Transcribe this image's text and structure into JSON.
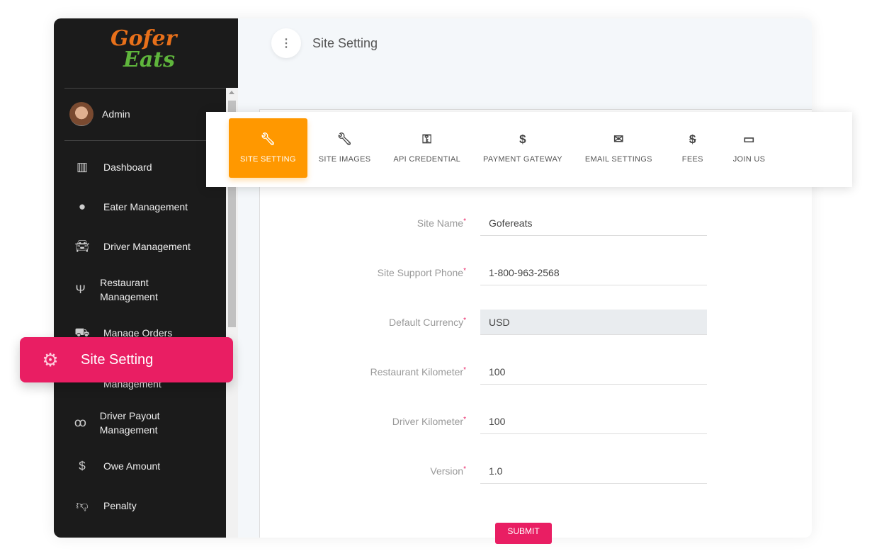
{
  "brand": {
    "logo_text_1": "Gofer",
    "logo_text_2": "Eats"
  },
  "user": {
    "name": "Admin"
  },
  "sidebar": {
    "items": [
      {
        "label": "Dashboard",
        "icon": "bar-chart-icon"
      },
      {
        "label": "Eater Management",
        "icon": "account-circle-icon"
      },
      {
        "label": "Driver Management",
        "icon": "car-icon"
      },
      {
        "label": "Restaurant Management",
        "icon": "restaurant-icon"
      },
      {
        "label": "Manage Orders",
        "icon": "cart-icon"
      },
      {
        "label": "Management",
        "icon": "payout-icon"
      },
      {
        "label": "Driver Payout Management",
        "icon": "motorcycle-icon"
      },
      {
        "label": "Owe Amount",
        "icon": "dollar-icon"
      },
      {
        "label": "Penalty",
        "icon": "thumbs-down-icon"
      }
    ]
  },
  "highlight": {
    "label": "Site Setting",
    "icon": "gear-icon",
    "color": "#e91e63"
  },
  "header": {
    "title": "Site Setting",
    "menu_icon": "more-vertical-icon"
  },
  "tabs": [
    {
      "label": "SITE SETTING",
      "icon": "wrench-icon",
      "active": true
    },
    {
      "label": "SITE IMAGES",
      "icon": "wrench-icon"
    },
    {
      "label": "API CREDENTIAL",
      "icon": "key-icon"
    },
    {
      "label": "PAYMENT GATEWAY",
      "icon": "dollar-icon"
    },
    {
      "label": "EMAIL SETTINGS",
      "icon": "mail-icon"
    },
    {
      "label": "FEES",
      "icon": "no-dollar-icon"
    },
    {
      "label": "JOIN US",
      "icon": "devices-icon"
    }
  ],
  "accent": "#ff9800",
  "form": {
    "fields": [
      {
        "label": "Site Name",
        "value": "Gofereats"
      },
      {
        "label": "Site Support Phone",
        "value": "1-800-963-2568"
      },
      {
        "label": "Default Currency",
        "value": "USD",
        "disabled": true
      },
      {
        "label": "Restaurant Kilometer",
        "value": "100"
      },
      {
        "label": "Driver Kilometer",
        "value": "100"
      },
      {
        "label": "Version",
        "value": "1.0"
      }
    ],
    "required_mark": "*",
    "submit": "SUBMIT"
  }
}
